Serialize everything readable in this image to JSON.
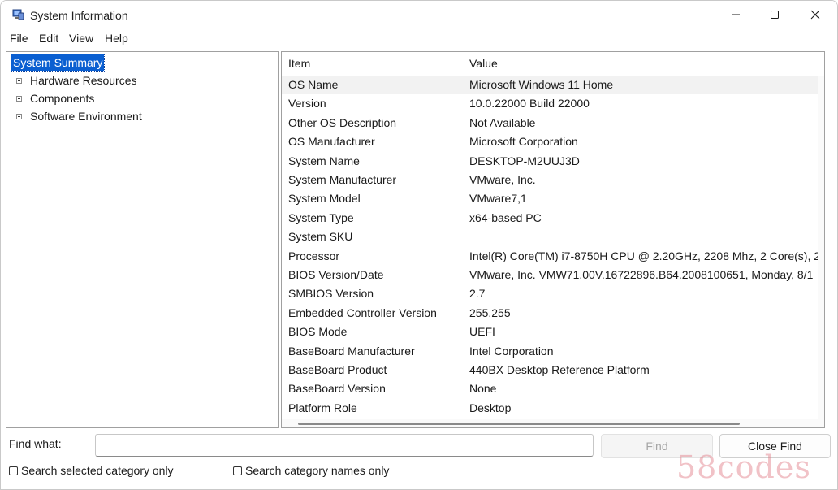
{
  "window": {
    "title": "System Information",
    "icon": "system-info-app-icon"
  },
  "menu": [
    "File",
    "Edit",
    "View",
    "Help"
  ],
  "tree": {
    "selected": "System Summary",
    "children": [
      "Hardware Resources",
      "Components",
      "Software Environment"
    ]
  },
  "list": {
    "columns": [
      "Item",
      "Value"
    ],
    "rows": [
      {
        "item": "OS Name",
        "value": "Microsoft Windows 11 Home"
      },
      {
        "item": "Version",
        "value": "10.0.22000 Build 22000"
      },
      {
        "item": "Other OS Description",
        "value": "Not Available"
      },
      {
        "item": "OS Manufacturer",
        "value": "Microsoft Corporation"
      },
      {
        "item": "System Name",
        "value": "DESKTOP-M2UUJ3D"
      },
      {
        "item": "System Manufacturer",
        "value": "VMware, Inc."
      },
      {
        "item": "System Model",
        "value": "VMware7,1"
      },
      {
        "item": "System Type",
        "value": "x64-based PC"
      },
      {
        "item": "System SKU",
        "value": ""
      },
      {
        "item": "Processor",
        "value": "Intel(R) Core(TM) i7-8750H CPU @ 2.20GHz, 2208 Mhz, 2 Core(s), 2"
      },
      {
        "item": "BIOS Version/Date",
        "value": "VMware, Inc. VMW71.00V.16722896.B64.2008100651, Monday, 8/1"
      },
      {
        "item": "SMBIOS Version",
        "value": "2.7"
      },
      {
        "item": "Embedded Controller Version",
        "value": "255.255"
      },
      {
        "item": "BIOS Mode",
        "value": "UEFI"
      },
      {
        "item": "BaseBoard Manufacturer",
        "value": "Intel Corporation"
      },
      {
        "item": "BaseBoard Product",
        "value": "440BX Desktop Reference Platform"
      },
      {
        "item": "BaseBoard Version",
        "value": "None"
      },
      {
        "item": "Platform Role",
        "value": "Desktop"
      }
    ]
  },
  "find": {
    "label": "Find what:",
    "value": "",
    "find_button": "Find",
    "close_find_button": "Close Find",
    "search_selected_label": "Search selected category only",
    "search_names_label": "Search category names only"
  },
  "watermark": "58codes",
  "colors": {
    "selection": "#0a5fd1",
    "disabled_text": "#a5a5a5"
  }
}
